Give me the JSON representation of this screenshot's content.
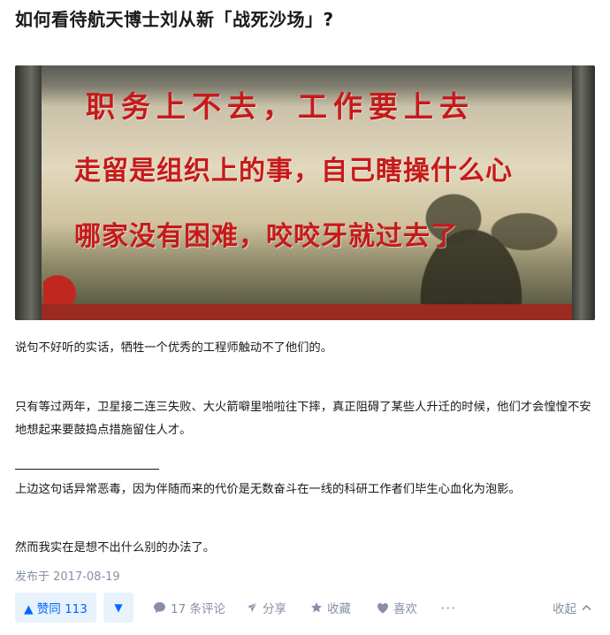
{
  "question": {
    "title": "如何看待航天博士刘从新「战死沙场」?"
  },
  "banner": {
    "slogans": [
      "职务上不去，工作要上去",
      "走留是组织上的事，自己瞎操什么心",
      "哪家没有困难，咬咬牙就过去了"
    ]
  },
  "answer": {
    "paragraphs": [
      "说句不好听的实话，牺牲一个优秀的工程师触动不了他们的。",
      "只有等过两年，卫星接二连三失败、大火箭噼里啪啦往下摔，真正阻碍了某些人升迁的时候，他们才会惶惶不安地想起来要鼓捣点措施留住人才。",
      "上边这句话异常恶毒，因为伴随而来的代价是无数奋斗在一线的科研工作者们毕生心血化为泡影。",
      "然而我实在是想不出什么别的办法了。"
    ],
    "published": "发布于 2017-08-19"
  },
  "actions": {
    "vote_up": "▲ 赞同 113",
    "vote_down": "▼",
    "comment": "17 条评论",
    "share": "分享",
    "collect": "收藏",
    "like": "喜欢",
    "more": "···",
    "collapse": "收起"
  },
  "colors": {
    "accent": "#0066ff",
    "vote_bg": "#e8f2fd",
    "muted": "#8590a6",
    "slogan_red": "#c61a1a"
  }
}
